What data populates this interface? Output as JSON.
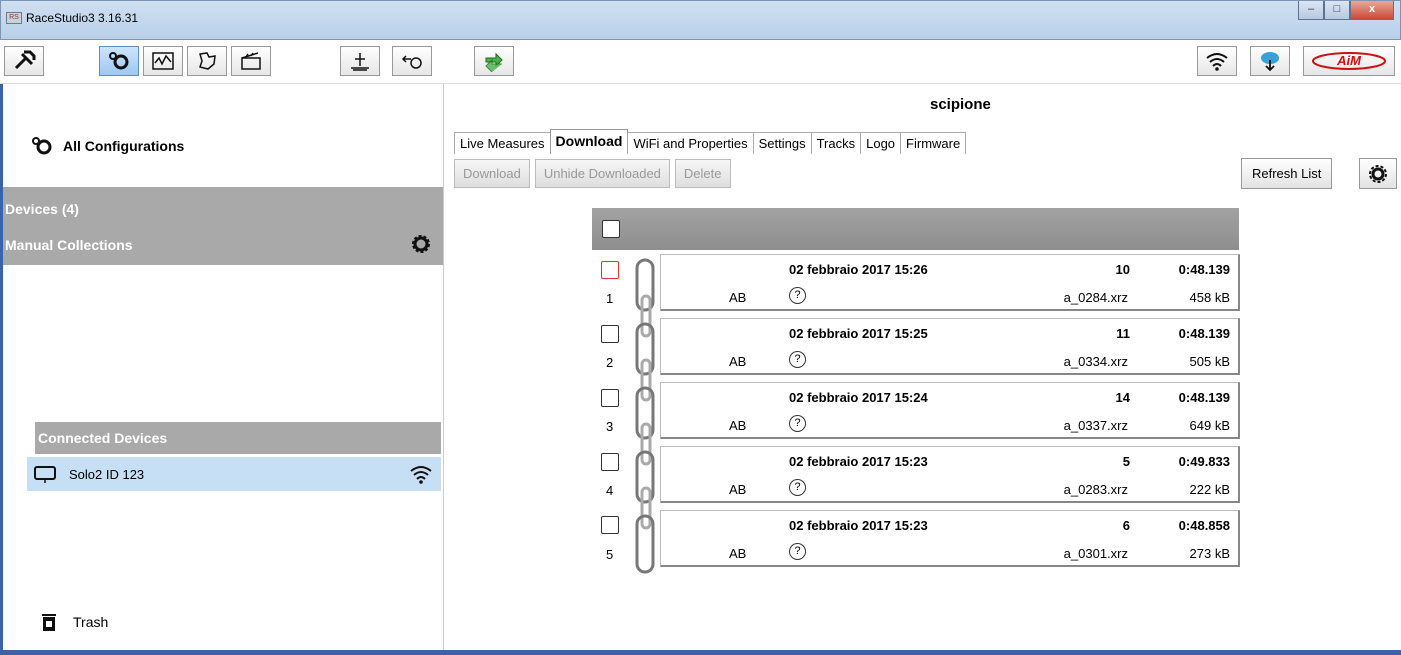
{
  "window": {
    "title": "RaceStudio3 3.16.31",
    "minimize": "–",
    "maximize": "□",
    "close": "x"
  },
  "toolbar": {
    "icons": [
      "tools-icon",
      "configuration-icon",
      "analysis-icon",
      "tracks-icon",
      "video-icon",
      "math-icon",
      "import-icon",
      "download-icon",
      "wifi-icon",
      "cloud-icon",
      "aim-logo"
    ],
    "brand": "AiM"
  },
  "sidebar": {
    "all_configurations": "All Configurations",
    "devices": "Devices  (4)",
    "manual_collections": "Manual Collections",
    "connected_devices": "Connected Devices",
    "connected_item": "Solo2 ID 123",
    "trash": "Trash"
  },
  "main": {
    "device_name": "scipione",
    "tabs": [
      {
        "label": "Live Measures",
        "active": false
      },
      {
        "label": "Download",
        "active": true
      },
      {
        "label": "WiFi and Properties",
        "active": false
      },
      {
        "label": "Settings",
        "active": false
      },
      {
        "label": "Tracks",
        "active": false
      },
      {
        "label": "Logo",
        "active": false
      },
      {
        "label": "Firmware",
        "active": false
      }
    ],
    "actions": {
      "download": "Download",
      "unhide": "Unhide Downloaded",
      "delete": "Delete",
      "refresh": "Refresh List"
    },
    "rows": [
      {
        "index": "1",
        "date": "02 febbraio 2017 15:26",
        "laps": "10",
        "time": "0:48.139",
        "driver": "AB",
        "help": "?",
        "file": "a_0284.xrz",
        "size": "458 kB",
        "highlight": true
      },
      {
        "index": "2",
        "date": "02 febbraio 2017 15:25",
        "laps": "11",
        "time": "0:48.139",
        "driver": "AB",
        "help": "?",
        "file": "a_0334.xrz",
        "size": "505 kB",
        "highlight": false
      },
      {
        "index": "3",
        "date": "02 febbraio 2017 15:24",
        "laps": "14",
        "time": "0:48.139",
        "driver": "AB",
        "help": "?",
        "file": "a_0337.xrz",
        "size": "649 kB",
        "highlight": false
      },
      {
        "index": "4",
        "date": "02 febbraio 2017 15:23",
        "laps": "5",
        "time": "0:49.833",
        "driver": "AB",
        "help": "?",
        "file": "a_0283.xrz",
        "size": "222 kB",
        "highlight": false
      },
      {
        "index": "5",
        "date": "02 febbraio 2017 15:23",
        "laps": "6",
        "time": "0:48.858",
        "driver": "AB",
        "help": "?",
        "file": "a_0301.xrz",
        "size": "273 kB",
        "highlight": false
      }
    ]
  },
  "colors": {
    "accent": "#3a63a8",
    "selection": "#c7dff5",
    "panel_gray": "#a9a9a9",
    "highlight_checkbox": "#dd3333"
  }
}
